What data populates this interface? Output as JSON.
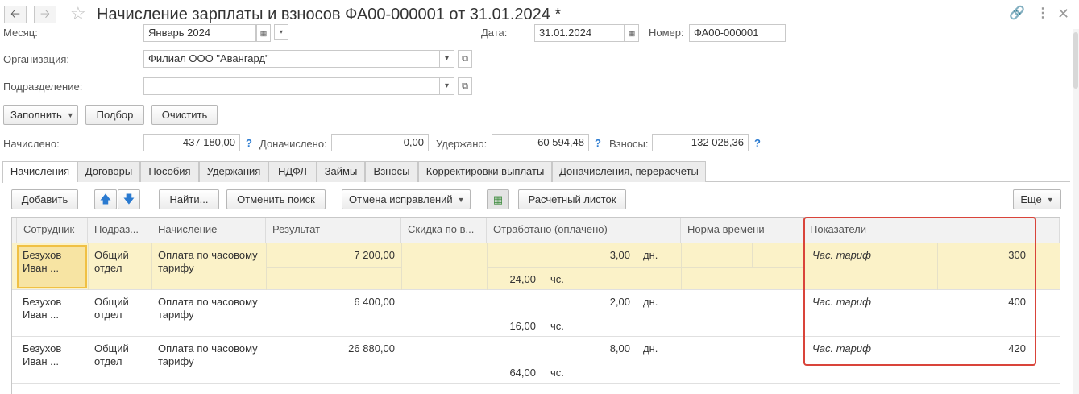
{
  "window": {
    "title": "Начисление зарплаты и взносов ФА00-000001 от 31.01.2024 *",
    "back_icon": "arrow-left-icon",
    "forward_icon": "arrow-right-icon",
    "favorite_icon": "star-icon",
    "link_icon": "link-icon",
    "menu_icon": "more-vertical-icon",
    "close_icon": "close-icon"
  },
  "header": {
    "month_label": "Месяц:",
    "month_value": "Январь 2024",
    "date_label": "Дата:",
    "date_value": "31.01.2024",
    "number_label": "Номер:",
    "number_value": "ФА00-000001",
    "org_label": "Организация:",
    "org_value": "Филиал ООО \"Авангард\"",
    "dept_label": "Подразделение:",
    "dept_value": ""
  },
  "actions": {
    "fill": "Заполнить",
    "pick": "Подбор",
    "clear": "Очистить"
  },
  "totals": {
    "accrued_label": "Начислено:",
    "accrued_value": "437 180,00",
    "extra_label": "Доначислено:",
    "extra_value": "0,00",
    "withheld_label": "Удержано:",
    "withheld_value": "60 594,48",
    "contrib_label": "Взносы:",
    "contrib_value": "132 028,36",
    "help": "?"
  },
  "tabs": [
    "Начисления",
    "Договоры",
    "Пособия",
    "Удержания",
    "НДФЛ",
    "Займы",
    "Взносы",
    "Корректировки выплаты",
    "Доначисления, перерасчеты"
  ],
  "toolbar": {
    "add": "Добавить",
    "find": "Найти...",
    "cancel_search": "Отменить поиск",
    "cancel_fix": "Отмена исправлений",
    "payslip": "Расчетный листок",
    "more": "Еще",
    "up_icon": "arrow-up-icon",
    "down_icon": "arrow-down-icon",
    "grid_icon": "table-add-icon"
  },
  "table": {
    "columns": [
      "Сотрудник",
      "Подраз...",
      "Начисление",
      "Результат",
      "Скидка по в...",
      "Отработано (оплачено)",
      "Норма времени",
      "Показатели"
    ],
    "rows": [
      {
        "employee1": "Безухов",
        "employee2": "Иван ...",
        "dept1": "Общий",
        "dept2": "отдел",
        "accrual1": "Оплата по часовому",
        "accrual2": "тарифу",
        "result": "7 200,00",
        "worked_days": "3,00",
        "days_unit": "дн.",
        "worked_hours": "24,00",
        "hours_unit": "чс.",
        "indicator": "Час. тариф",
        "indicator_value": "300"
      },
      {
        "employee1": "Безухов",
        "employee2": "Иван ...",
        "dept1": "Общий",
        "dept2": "отдел",
        "accrual1": "Оплата по часовому",
        "accrual2": "тарифу",
        "result": "6 400,00",
        "worked_days": "2,00",
        "days_unit": "дн.",
        "worked_hours": "16,00",
        "hours_unit": "чс.",
        "indicator": "Час. тариф",
        "indicator_value": "400"
      },
      {
        "employee1": "Безухов",
        "employee2": "Иван ...",
        "dept1": "Общий",
        "dept2": "отдел",
        "accrual1": "Оплата по часовому",
        "accrual2": "тарифу",
        "result": "26 880,00",
        "worked_days": "8,00",
        "days_unit": "дн.",
        "worked_hours": "64,00",
        "hours_unit": "чс.",
        "indicator": "Час. тариф",
        "indicator_value": "420"
      }
    ]
  },
  "colors": {
    "selected_row": "#fbf2c8",
    "highlight_frame": "#d9443a",
    "help_link": "#2a7ad0"
  }
}
